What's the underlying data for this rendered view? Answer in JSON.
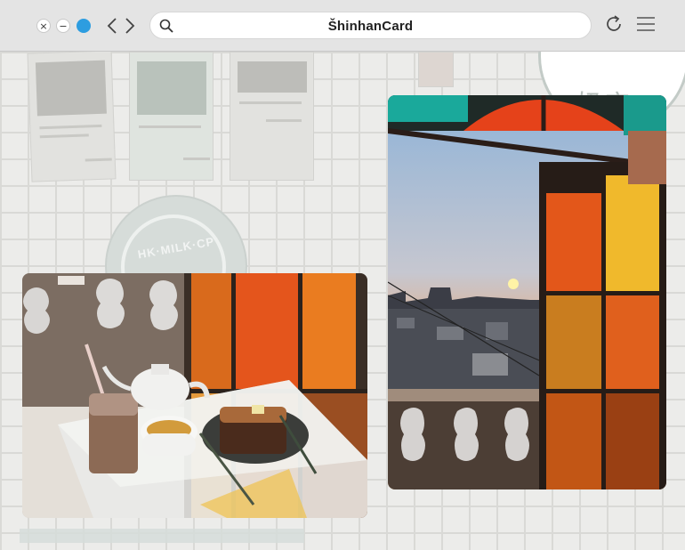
{
  "browser": {
    "url_text": "ŠhinhanCard",
    "window_buttons": [
      {
        "name": "close",
        "glyph": "×"
      },
      {
        "name": "minimize",
        "glyph": "−"
      },
      {
        "name": "maximize",
        "glyph": ""
      }
    ],
    "icons": {
      "back": "chevron-left-icon",
      "forward": "chevron-right-icon",
      "search": "search-icon",
      "reload": "reload-icon",
      "menu": "hamburger-menu-icon"
    },
    "accent_color": "#2d9de0"
  },
  "page": {
    "background_sign_text": "HK·MILK·CP",
    "corner_sign_text": "奶店",
    "photos": [
      {
        "name": "cafe-photo",
        "subject": "iced coffee, teapot, tea cup and toast on glass table by stained-glass window"
      },
      {
        "name": "sunset-photo",
        "subject": "sunset over city seen through stained-glass window"
      }
    ]
  }
}
